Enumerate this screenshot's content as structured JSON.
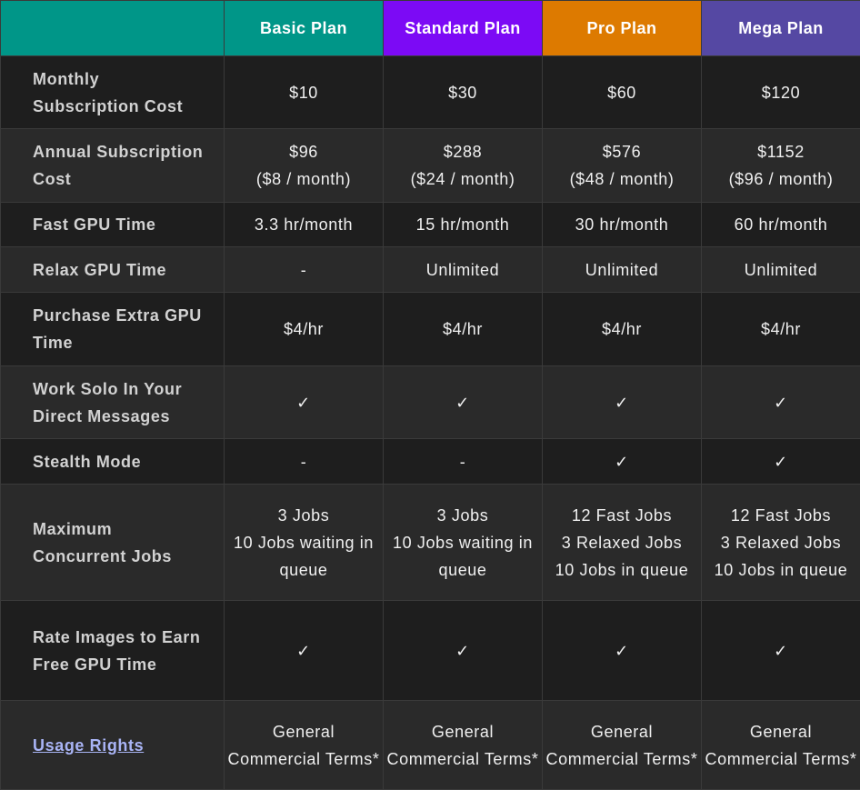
{
  "plans": [
    {
      "name": "Basic Plan",
      "color": "#009688"
    },
    {
      "name": "Standard Plan",
      "color": "#7C0AF5"
    },
    {
      "name": "Pro Plan",
      "color": "#DD7A00"
    },
    {
      "name": "Mega Plan",
      "color": "#5548A3"
    }
  ],
  "rows": [
    {
      "id": "monthly-cost",
      "feature": "Monthly Subscription Cost",
      "values": [
        "$10",
        "$30",
        "$60",
        "$120"
      ]
    },
    {
      "id": "annual-cost",
      "feature": "Annual Subscription Cost",
      "values": [
        "$96\n($8 / month)",
        "$288\n($24 / month)",
        "$576\n($48 / month)",
        "$1152\n($96 / month)"
      ]
    },
    {
      "id": "fast-gpu-time",
      "feature": "Fast GPU Time",
      "values": [
        "3.3 hr/month",
        "15 hr/month",
        "30 hr/month",
        "60 hr/month"
      ]
    },
    {
      "id": "relax-gpu-time",
      "feature": "Relax GPU Time",
      "values": [
        "-",
        "Unlimited",
        "Unlimited",
        "Unlimited"
      ]
    },
    {
      "id": "purchase-extra-gpu",
      "feature": "Purchase Extra GPU Time",
      "values": [
        "$4/hr",
        "$4/hr",
        "$4/hr",
        "$4/hr"
      ]
    },
    {
      "id": "work-solo",
      "feature": "Work Solo In Your Direct Messages",
      "values": [
        "✓",
        "✓",
        "✓",
        "✓"
      ]
    },
    {
      "id": "stealth-mode",
      "feature": "Stealth Mode",
      "values": [
        "-",
        "-",
        "✓",
        "✓"
      ]
    },
    {
      "id": "max-concurrent-jobs",
      "feature": "Maximum Concurrent Jobs",
      "values": [
        "3 Jobs\n10 Jobs waiting in queue",
        "3 Jobs\n10 Jobs waiting in queue",
        "12 Fast Jobs\n3 Relaxed Jobs\n10 Jobs in queue",
        "12 Fast Jobs\n3 Relaxed Jobs\n10 Jobs in queue"
      ]
    },
    {
      "id": "rate-images",
      "feature": "Rate Images to Earn Free GPU Time",
      "values": [
        "✓",
        "✓",
        "✓",
        "✓"
      ]
    },
    {
      "id": "usage-rights",
      "feature": "Usage Rights",
      "link": true,
      "values": [
        "General Commercial Terms*",
        "General Commercial Terms*",
        "General Commercial Terms*",
        "General Commercial Terms*"
      ]
    }
  ]
}
